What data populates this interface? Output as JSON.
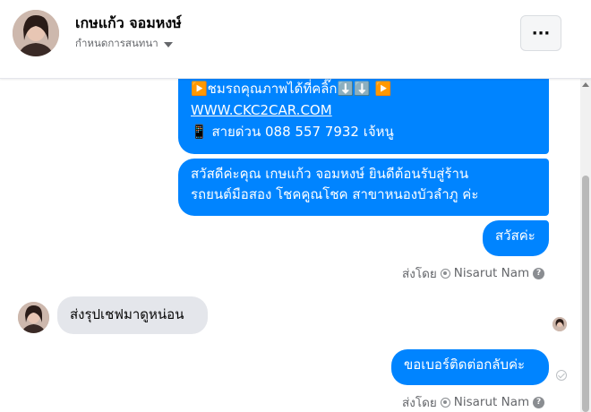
{
  "header": {
    "contact_name": "เกษแก้ว จอมหงษ์",
    "subtitle": "กำหนดการสนทนา",
    "menu_label": "···"
  },
  "messages": {
    "car_promo": {
      "line1": "▶️ชมรถคุณภาพได้ที่คลิ๊ก⬇️⬇️      ▶️",
      "link": "WWW.CKC2CAR.COM",
      "hotline": "📱 สายด่วน 088 557 7932 เจ้หนู"
    },
    "welcome": {
      "line1": "สวัสดีค่ะคุณ เกษแก้ว จอมหงษ์ ยินดีต้อนรับสู่ร้าน",
      "line2": "รถยนต์มือสอง โชคคูณโชค สาขาหนองบัวลำภู ค่ะ"
    },
    "greeting": "สวัสค่ะ",
    "incoming": "ส่งรุปเชฟมาดูหน่อน",
    "request_number": "ขอเบอร์ติดต่อกลับค่ะ"
  },
  "sent_by": {
    "prefix": "ส่งโดย",
    "name": "Nisarut Nam",
    "help": "?"
  },
  "colors": {
    "outgoing_bubble": "#0084ff",
    "incoming_bubble": "#e4e6eb"
  },
  "icons": {
    "menu": "more-horizontal-icon",
    "caret": "chevron-down-icon",
    "seen": "seen-avatar-icon",
    "delivered": "check-circle-icon"
  }
}
